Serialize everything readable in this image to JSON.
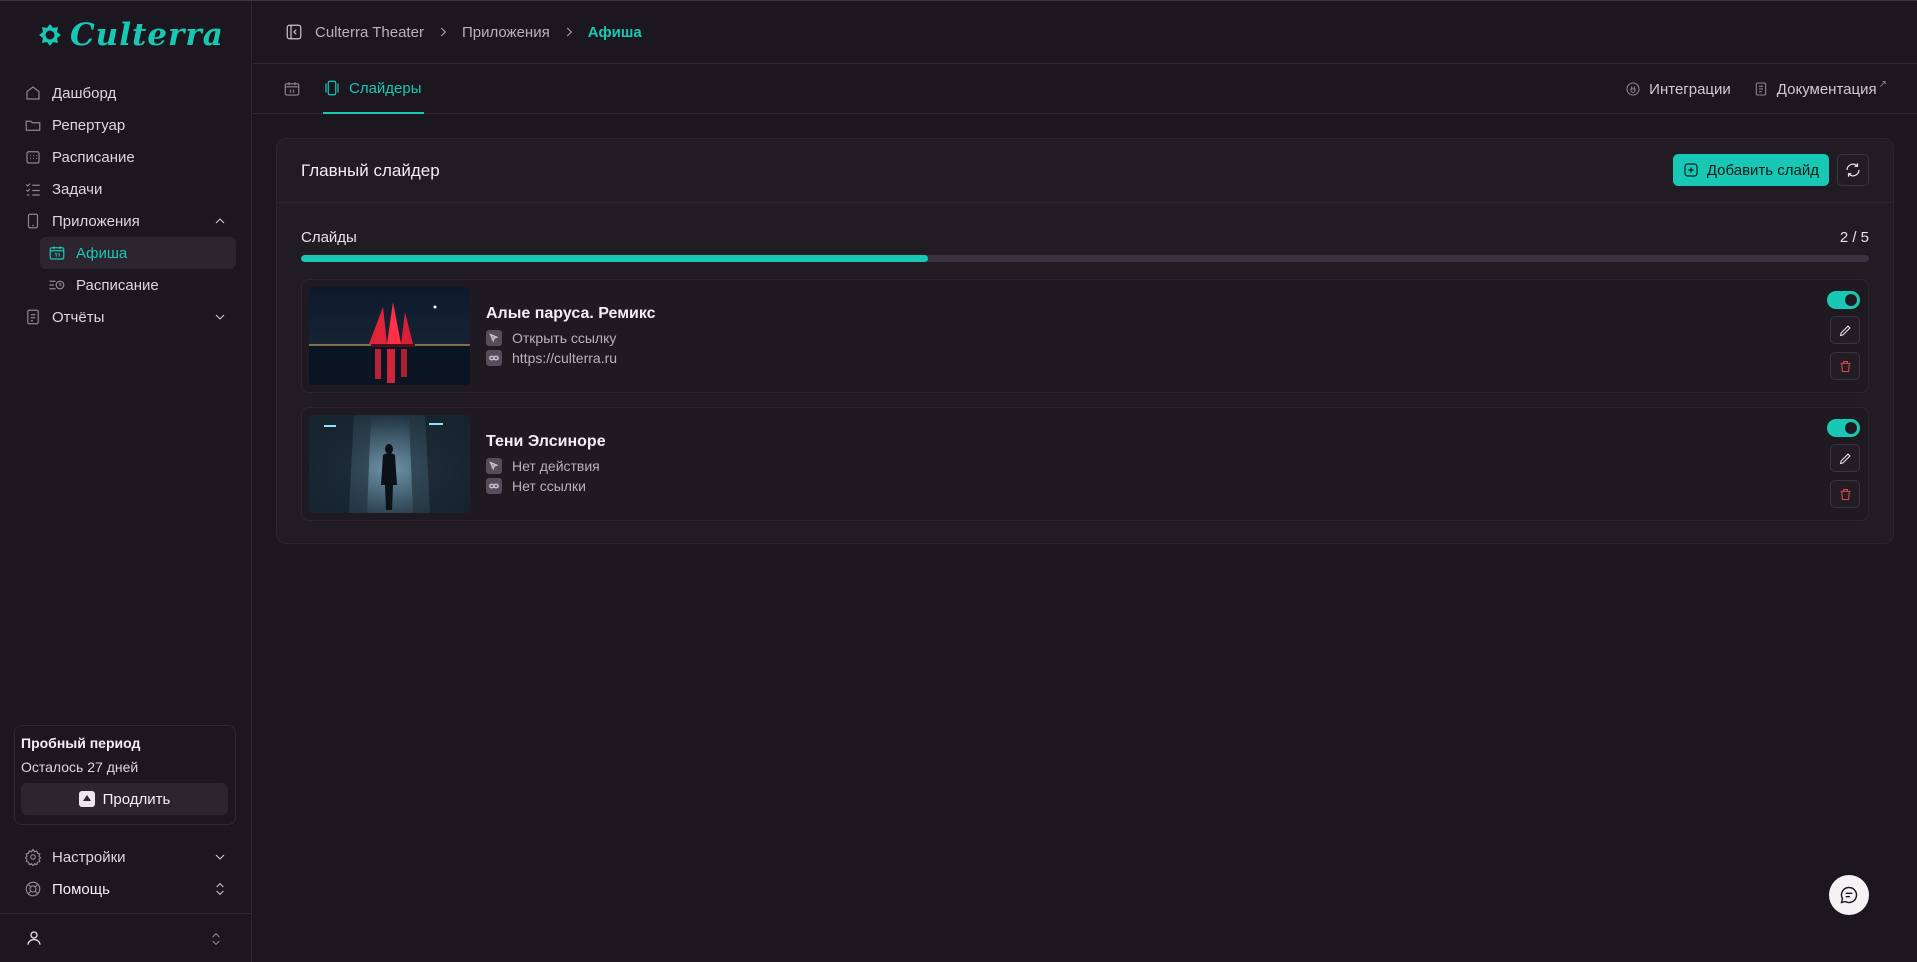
{
  "brand": {
    "name": "Culterra",
    "accent": "#19c8b4"
  },
  "sidebar": {
    "items": [
      {
        "label": "Дашборд",
        "icon": "home-icon"
      },
      {
        "label": "Репертуар",
        "icon": "folder-icon"
      },
      {
        "label": "Расписание",
        "icon": "calendar-grid-icon"
      },
      {
        "label": "Задачи",
        "icon": "tasks-icon"
      },
      {
        "label": "Приложения",
        "icon": "tablet-icon",
        "expanded": true
      },
      {
        "label": "Отчёты",
        "icon": "report-icon",
        "expanded": false
      }
    ],
    "sub_items": [
      {
        "label": "Афиша",
        "icon": "calendar-icon",
        "active": true
      },
      {
        "label": "Расписание",
        "icon": "schedule-list-icon",
        "active": false
      }
    ],
    "trial": {
      "title": "Пробный период",
      "subtitle": "Осталось 27 дней",
      "button": "Продлить"
    },
    "bottom": [
      {
        "label": "Настройки",
        "icon": "gear-icon"
      },
      {
        "label": "Помощь",
        "icon": "lifebuoy-icon"
      }
    ]
  },
  "breadcrumb": {
    "items": [
      "Culterra Theater",
      "Приложения",
      "Афиша"
    ]
  },
  "tabs": {
    "active": "Слайдеры",
    "links": [
      "Интеграции",
      "Документация"
    ]
  },
  "slider": {
    "title": "Главный слайдер",
    "add_button": "Добавить слайд",
    "progress_label": "Слайды",
    "progress_count": "2 / 5",
    "progress_fraction": 0.4,
    "slides": [
      {
        "title": "Алые паруса. Ремикс",
        "action": "Открыть ссылку",
        "link": "https://culterra.ru",
        "enabled": true
      },
      {
        "title": "Тени Элсиноре",
        "action": "Нет действия",
        "link": "Нет ссылки",
        "enabled": true
      }
    ]
  }
}
